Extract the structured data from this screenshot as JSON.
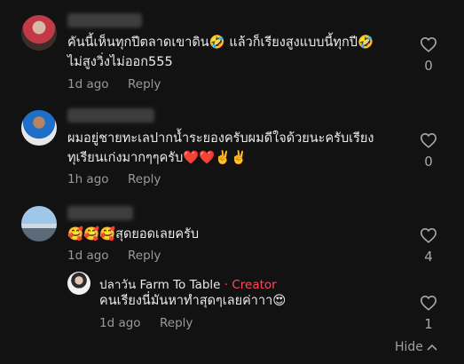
{
  "comments": [
    {
      "text_line1": "คันนี้เห็นทุกปีตลาดเขาดิน🤣 แล้วก็เรียงสูงแบบนี้ทุกปี🤣",
      "text_line2": "ไม่สูงวิ่งไม่ออก555",
      "time": "1d ago",
      "reply_label": "Reply",
      "likes": "0"
    },
    {
      "text_line1": "ผมอยู่ชายทะเลปากน้ำระยองครับผมดีใจด้วยนะครับเรียง",
      "text_line2": "ทุเรียนเก่งมากๆๆครับ❤️❤️✌️✌️",
      "time": "1h ago",
      "reply_label": "Reply",
      "likes": "0"
    },
    {
      "text_line1": "🥰🥰🥰สุดยอดเลยครับ",
      "time": "1d ago",
      "reply_label": "Reply",
      "likes": "4"
    }
  ],
  "reply": {
    "author": "ปลาวัน Farm To Table",
    "separator": " · ",
    "creator_label": "Creator",
    "text": "คนเรียงนี่มันหาทำสุดๆเลยค่าาา😍",
    "time": "1d ago",
    "reply_label": "Reply",
    "likes": "1"
  },
  "hide_label": "Hide"
}
